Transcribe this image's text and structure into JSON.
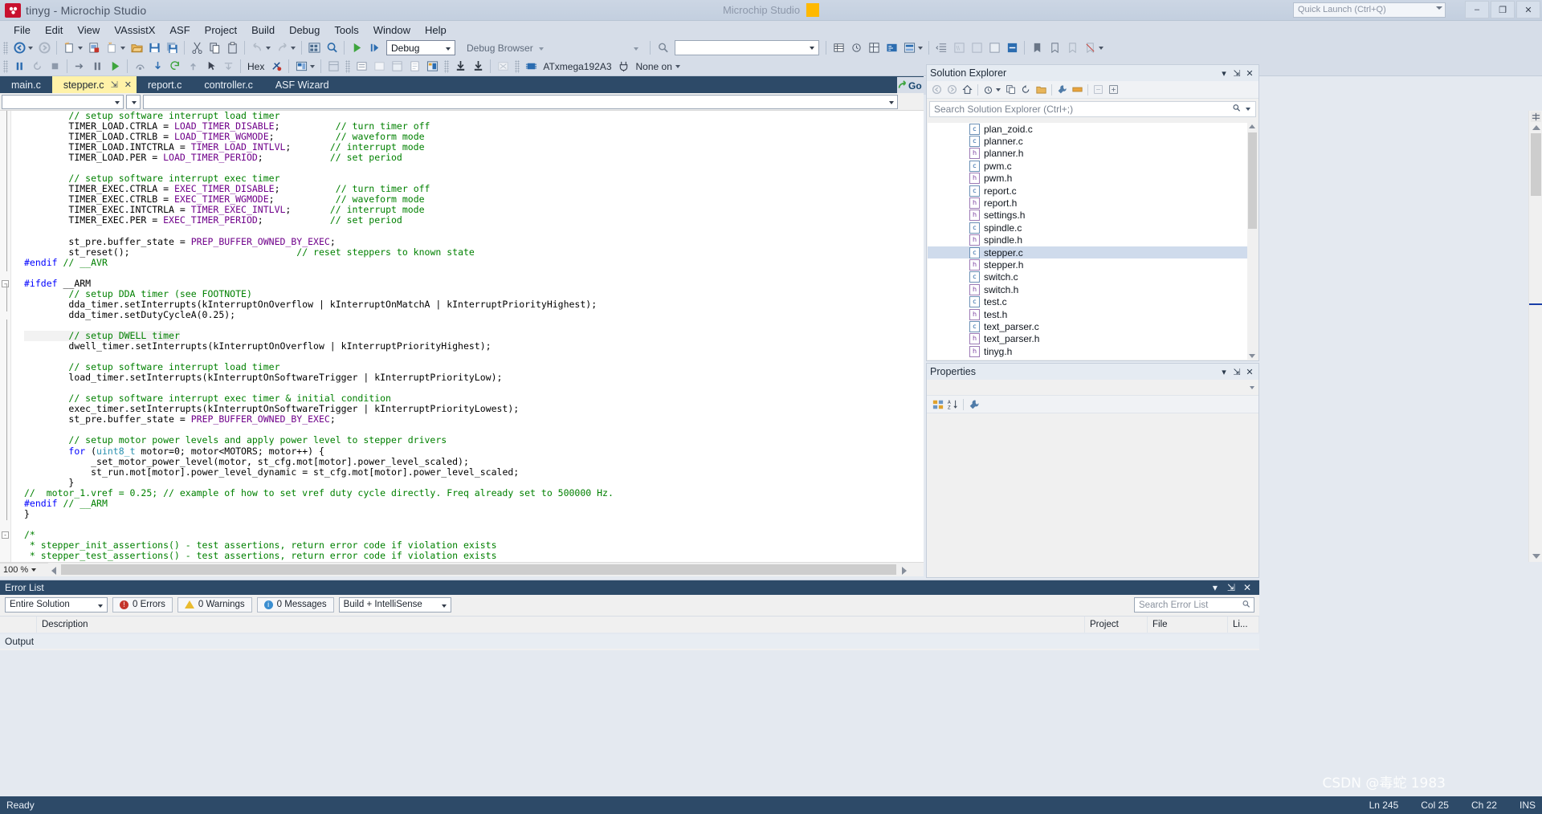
{
  "window": {
    "title": "tinyg - Microchip Studio",
    "center_label": "Microchip Studio",
    "center_badge": "",
    "quick_launch_placeholder": "Quick Launch (Ctrl+Q)",
    "minimize": "–",
    "maximize": "❐",
    "close": "✕"
  },
  "menu": {
    "items": [
      "File",
      "Edit",
      "View",
      "VAssistX",
      "ASF",
      "Project",
      "Build",
      "Debug",
      "Tools",
      "Window",
      "Help"
    ]
  },
  "toolbar1": {
    "navigate_back": "back-icon",
    "navigate_forward": "forward-icon",
    "new_project": "new-project-icon",
    "add_existing": "add-existing-icon",
    "new_item": "new-item-icon",
    "open_file": "open-folder-icon",
    "save": "save-icon",
    "save_all": "save-all-icon",
    "cut": "cut-icon",
    "copy": "copy-icon",
    "paste": "paste-icon",
    "undo": "undo-icon",
    "redo": "redo-icon",
    "solution_layout": "grid-icon",
    "find": "magnifier-icon",
    "start_debug": "play-icon",
    "step": "step-icon",
    "config_value": "Debug",
    "debug_browser_label": "Debug Browser",
    "search_value": ""
  },
  "toolbar2": {
    "hex_label": "Hex",
    "device_label": "ATxmega192A3",
    "tool_label": "None on",
    "breakall": "break-all-icon",
    "stop": "stop-icon",
    "step_into": "step-into-icon",
    "step_over": "step-over-icon",
    "run": "run-icon"
  },
  "tabs": {
    "items": [
      {
        "label": "main.c",
        "active": false
      },
      {
        "label": "stepper.c",
        "active": true
      },
      {
        "label": "report.c",
        "active": false
      },
      {
        "label": "controller.c",
        "active": false
      },
      {
        "label": "ASF Wizard",
        "active": false
      }
    ],
    "pin_glyph": "⇲",
    "close_glyph": "✕"
  },
  "navbar": {
    "scope_value": "",
    "member_value": "",
    "go_label": "Go"
  },
  "editor": {
    "zoom_level": "100 %",
    "lines": [
      {
        "indent": 2,
        "spans": [
          {
            "t": "// setup software interrupt load timer",
            "c": "cmt"
          }
        ]
      },
      {
        "indent": 2,
        "spans": [
          {
            "t": "TIMER_LOAD.CTRLA = ",
            "c": ""
          },
          {
            "t": "LOAD_TIMER_DISABLE",
            "c": "mac"
          },
          {
            "t": ";",
            "c": ""
          },
          {
            "t": "          ",
            "c": ""
          },
          {
            "t": "// turn timer off",
            "c": "cmt"
          }
        ]
      },
      {
        "indent": 2,
        "spans": [
          {
            "t": "TIMER_LOAD.CTRLB = ",
            "c": ""
          },
          {
            "t": "LOAD_TIMER_WGMODE",
            "c": "mac"
          },
          {
            "t": ";",
            "c": ""
          },
          {
            "t": "           ",
            "c": ""
          },
          {
            "t": "// waveform mode",
            "c": "cmt"
          }
        ]
      },
      {
        "indent": 2,
        "spans": [
          {
            "t": "TIMER_LOAD.INTCTRLA = ",
            "c": ""
          },
          {
            "t": "TIMER_LOAD_INTLVL",
            "c": "mac"
          },
          {
            "t": ";",
            "c": ""
          },
          {
            "t": "       ",
            "c": ""
          },
          {
            "t": "// interrupt mode",
            "c": "cmt"
          }
        ]
      },
      {
        "indent": 2,
        "spans": [
          {
            "t": "TIMER_LOAD.PER = ",
            "c": ""
          },
          {
            "t": "LOAD_TIMER_PERIOD",
            "c": "mac"
          },
          {
            "t": ";",
            "c": ""
          },
          {
            "t": "            ",
            "c": ""
          },
          {
            "t": "// set period",
            "c": "cmt"
          }
        ]
      },
      {
        "indent": 0,
        "spans": []
      },
      {
        "indent": 2,
        "spans": [
          {
            "t": "// setup software interrupt exec timer",
            "c": "cmt"
          }
        ]
      },
      {
        "indent": 2,
        "spans": [
          {
            "t": "TIMER_EXEC.CTRLA = ",
            "c": ""
          },
          {
            "t": "EXEC_TIMER_DISABLE",
            "c": "mac"
          },
          {
            "t": ";",
            "c": ""
          },
          {
            "t": "          ",
            "c": ""
          },
          {
            "t": "// turn timer off",
            "c": "cmt"
          }
        ]
      },
      {
        "indent": 2,
        "spans": [
          {
            "t": "TIMER_EXEC.CTRLB = ",
            "c": ""
          },
          {
            "t": "EXEC_TIMER_WGMODE",
            "c": "mac"
          },
          {
            "t": ";",
            "c": ""
          },
          {
            "t": "           ",
            "c": ""
          },
          {
            "t": "// waveform mode",
            "c": "cmt"
          }
        ]
      },
      {
        "indent": 2,
        "spans": [
          {
            "t": "TIMER_EXEC.INTCTRLA = ",
            "c": ""
          },
          {
            "t": "TIMER_EXEC_INTLVL",
            "c": "mac"
          },
          {
            "t": ";",
            "c": ""
          },
          {
            "t": "       ",
            "c": ""
          },
          {
            "t": "// interrupt mode",
            "c": "cmt"
          }
        ]
      },
      {
        "indent": 2,
        "spans": [
          {
            "t": "TIMER_EXEC.PER = ",
            "c": ""
          },
          {
            "t": "EXEC_TIMER_PERIOD",
            "c": "mac"
          },
          {
            "t": ";",
            "c": ""
          },
          {
            "t": "            ",
            "c": ""
          },
          {
            "t": "// set period",
            "c": "cmt"
          }
        ]
      },
      {
        "indent": 0,
        "spans": []
      },
      {
        "indent": 2,
        "spans": [
          {
            "t": "st_pre.buffer_state = ",
            "c": ""
          },
          {
            "t": "PREP_BUFFER_OWNED_BY_EXEC",
            "c": "mac"
          },
          {
            "t": ";",
            "c": ""
          }
        ]
      },
      {
        "indent": 2,
        "spans": [
          {
            "t": "st_reset();",
            "c": ""
          },
          {
            "t": "                              ",
            "c": ""
          },
          {
            "t": "// reset steppers to known state",
            "c": "cmt"
          }
        ]
      },
      {
        "indent": 0,
        "spans": [
          {
            "t": "#endif",
            "c": "pre"
          },
          {
            "t": " ",
            "c": ""
          },
          {
            "t": "// __AVR",
            "c": "cmt"
          }
        ]
      },
      {
        "indent": 0,
        "spans": []
      },
      {
        "indent": 0,
        "spans": [
          {
            "t": "#ifdef",
            "c": "pre"
          },
          {
            "t": " __ARM",
            "c": ""
          }
        ],
        "fold": true
      },
      {
        "indent": 2,
        "spans": [
          {
            "t": "// setup DDA timer (see FOOTNOTE)",
            "c": "cmt"
          }
        ]
      },
      {
        "indent": 2,
        "spans": [
          {
            "t": "dda_timer.setInterrupts(kInterruptOnOverflow | kInterruptOnMatchA | kInterruptPriorityHighest);",
            "c": ""
          }
        ]
      },
      {
        "indent": 2,
        "spans": [
          {
            "t": "dda_timer.setDutyCycleA(0.25);",
            "c": ""
          }
        ]
      },
      {
        "indent": 0,
        "spans": []
      },
      {
        "indent": 2,
        "spans": [
          {
            "t": "// setup DWELL timer",
            "c": "cmt"
          }
        ],
        "highlight": true
      },
      {
        "indent": 2,
        "spans": [
          {
            "t": "dwell_timer.setInterrupts(kInterruptOnOverflow | kInterruptPriorityHighest);",
            "c": ""
          }
        ]
      },
      {
        "indent": 0,
        "spans": []
      },
      {
        "indent": 2,
        "spans": [
          {
            "t": "// setup software interrupt load timer",
            "c": "cmt"
          }
        ]
      },
      {
        "indent": 2,
        "spans": [
          {
            "t": "load_timer.setInterrupts(kInterruptOnSoftwareTrigger | kInterruptPriorityLow);",
            "c": ""
          }
        ]
      },
      {
        "indent": 0,
        "spans": []
      },
      {
        "indent": 2,
        "spans": [
          {
            "t": "// setup software interrupt exec timer & initial condition",
            "c": "cmt"
          }
        ]
      },
      {
        "indent": 2,
        "spans": [
          {
            "t": "exec_timer.setInterrupts(kInterruptOnSoftwareTrigger | kInterruptPriorityLowest);",
            "c": ""
          }
        ]
      },
      {
        "indent": 2,
        "spans": [
          {
            "t": "st_pre.buffer_state = ",
            "c": ""
          },
          {
            "t": "PREP_BUFFER_OWNED_BY_EXEC",
            "c": "mac"
          },
          {
            "t": ";",
            "c": ""
          }
        ]
      },
      {
        "indent": 0,
        "spans": []
      },
      {
        "indent": 2,
        "spans": [
          {
            "t": "// setup motor power levels and apply power level to stepper drivers",
            "c": "cmt"
          }
        ]
      },
      {
        "indent": 2,
        "spans": [
          {
            "t": "for",
            "c": "kw"
          },
          {
            "t": " (",
            "c": ""
          },
          {
            "t": "uint8_t",
            "c": "typ"
          },
          {
            "t": " motor=0; motor<MOTORS; motor++) {",
            "c": ""
          }
        ]
      },
      {
        "indent": 3,
        "spans": [
          {
            "t": "_set_motor_power_level(motor, st_cfg.mot[motor].power_level_scaled);",
            "c": ""
          }
        ]
      },
      {
        "indent": 3,
        "spans": [
          {
            "t": "st_run.mot[motor].power_level_dynamic = st_cfg.mot[motor].power_level_scaled;",
            "c": ""
          }
        ]
      },
      {
        "indent": 2,
        "spans": [
          {
            "t": "}",
            "c": ""
          }
        ]
      },
      {
        "indent": 0,
        "spans": [
          {
            "t": "//  motor_1.vref = 0.25; // example of how to set vref duty cycle directly. Freq already set to 500000 Hz.",
            "c": "cmt"
          }
        ]
      },
      {
        "indent": 0,
        "spans": [
          {
            "t": "#endif",
            "c": "pre"
          },
          {
            "t": " ",
            "c": ""
          },
          {
            "t": "// __ARM",
            "c": "cmt"
          }
        ]
      },
      {
        "indent": 0,
        "spans": [
          {
            "t": "}",
            "c": ""
          }
        ]
      },
      {
        "indent": 0,
        "spans": []
      },
      {
        "indent": 0,
        "spans": [
          {
            "t": "/*",
            "c": "cmt"
          }
        ],
        "fold": true
      },
      {
        "indent": 0,
        "spans": [
          {
            "t": " * stepper_init_assertions() - test assertions, return error code if violation exists",
            "c": "cmt"
          }
        ]
      },
      {
        "indent": 0,
        "spans": [
          {
            "t": " * stepper_test_assertions() - test assertions, return error code if violation exists",
            "c": "cmt"
          }
        ]
      },
      {
        "indent": 0,
        "spans": [
          {
            "t": " */",
            "c": "cmt"
          }
        ]
      }
    ]
  },
  "solution_explorer": {
    "title": "Solution Explorer",
    "search_placeholder": "Search Solution Explorer (Ctrl+;)",
    "pin_glyph": "⇲",
    "close_glyph": "✕",
    "dropdown_glyph": "▾",
    "files": [
      {
        "name": "plan_zoid.c",
        "kind": "c",
        "selected": false
      },
      {
        "name": "planner.c",
        "kind": "c",
        "selected": false
      },
      {
        "name": "planner.h",
        "kind": "h",
        "selected": false
      },
      {
        "name": "pwm.c",
        "kind": "c",
        "selected": false
      },
      {
        "name": "pwm.h",
        "kind": "h",
        "selected": false
      },
      {
        "name": "report.c",
        "kind": "c",
        "selected": false
      },
      {
        "name": "report.h",
        "kind": "h",
        "selected": false
      },
      {
        "name": "settings.h",
        "kind": "h",
        "selected": false
      },
      {
        "name": "spindle.c",
        "kind": "c",
        "selected": false
      },
      {
        "name": "spindle.h",
        "kind": "h",
        "selected": false
      },
      {
        "name": "stepper.c",
        "kind": "c",
        "selected": true
      },
      {
        "name": "stepper.h",
        "kind": "h",
        "selected": false
      },
      {
        "name": "switch.c",
        "kind": "c",
        "selected": false
      },
      {
        "name": "switch.h",
        "kind": "h",
        "selected": false
      },
      {
        "name": "test.c",
        "kind": "c",
        "selected": false
      },
      {
        "name": "test.h",
        "kind": "h",
        "selected": false
      },
      {
        "name": "text_parser.c",
        "kind": "c",
        "selected": false
      },
      {
        "name": "text_parser.h",
        "kind": "h",
        "selected": false
      },
      {
        "name": "tinyg.h",
        "kind": "h",
        "selected": false
      }
    ]
  },
  "properties": {
    "title": "Properties",
    "pin_glyph": "⇲",
    "close_glyph": "✕",
    "dropdown_glyph": "▾"
  },
  "error_list": {
    "title": "Error List",
    "pin_glyph": "⇲",
    "close_glyph": "✕",
    "dropdown_glyph": "▾",
    "scope_value": "Entire Solution",
    "errors_label": "0 Errors",
    "warnings_label": "0 Warnings",
    "messages_label": "0 Messages",
    "filter_value": "Build + IntelliSense",
    "search_placeholder": "Search Error List",
    "columns": [
      "",
      "Description",
      "Project",
      "File",
      "Li..."
    ]
  },
  "output": {
    "title": "Output"
  },
  "statusbar": {
    "message": "Ready",
    "line": "Ln 245",
    "col": "Col 25",
    "ch": "Ch 22",
    "ins": "INS"
  },
  "watermark": {
    "text": "CSDN @毒蛇 1983"
  },
  "colors": {
    "accent_dark": "#2d4a68",
    "active_tab": "#fff2a8",
    "comment_green": "#008000",
    "macro_purple": "#6f008a",
    "keyword_blue": "#0000ff",
    "selection_blue": "#cfdbec"
  }
}
